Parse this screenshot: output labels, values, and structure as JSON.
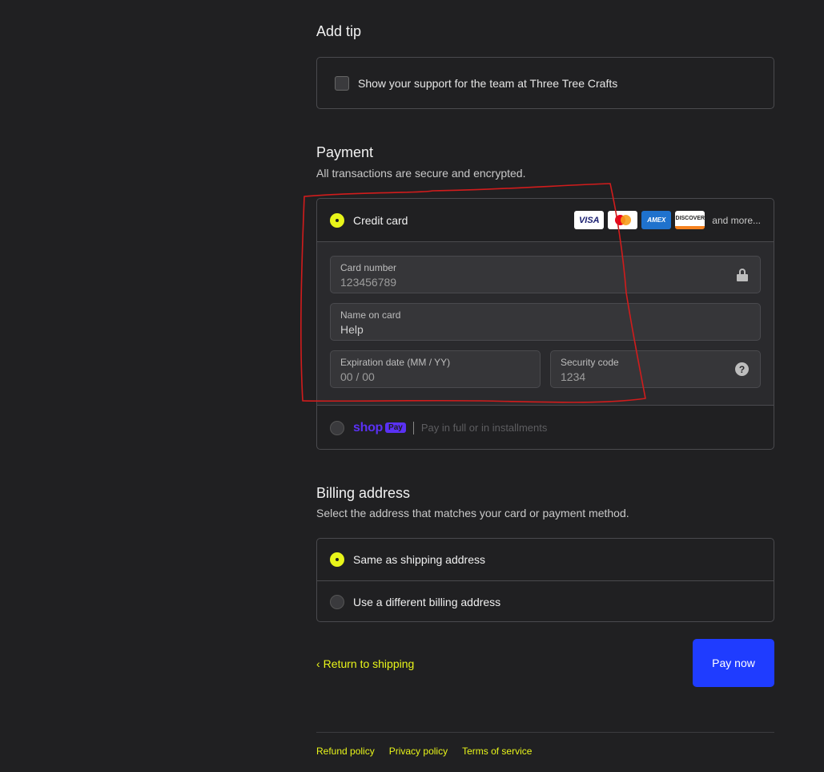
{
  "tip": {
    "title": "Add tip",
    "checkbox_label": "Show your support for the team at Three Tree Crafts"
  },
  "payment": {
    "title": "Payment",
    "subtitle": "All transactions are secure and encrypted.",
    "credit_card_label": "Credit card",
    "brands": [
      "VISA",
      "mastercard",
      "AMEX",
      "DISCOVER"
    ],
    "more_label": "and more...",
    "card_number": {
      "label": "Card number",
      "value": "123456789"
    },
    "name_on_card": {
      "label": "Name on card",
      "value": "Help"
    },
    "expiration": {
      "label": "Expiration date (MM / YY)",
      "value": "00 / 00"
    },
    "security_code": {
      "label": "Security code",
      "value": "1234"
    },
    "help_glyph": "?",
    "shop_pay": {
      "logo": "shop",
      "tag": "Pay",
      "text": "Pay in full or in installments"
    }
  },
  "billing": {
    "title": "Billing address",
    "subtitle": "Select the address that matches your card or payment method.",
    "options": [
      "Same as shipping address",
      "Use a different billing address"
    ]
  },
  "actions": {
    "return_chevron": "‹",
    "return_label": "Return to shipping",
    "pay_label": "Pay now"
  },
  "footer": {
    "links": [
      "Refund policy",
      "Privacy policy",
      "Terms of service"
    ]
  },
  "colors": {
    "accent": "#e8f51a",
    "pay_button": "#1f3cff",
    "background": "#202022",
    "annotation": "#d11c1c"
  }
}
